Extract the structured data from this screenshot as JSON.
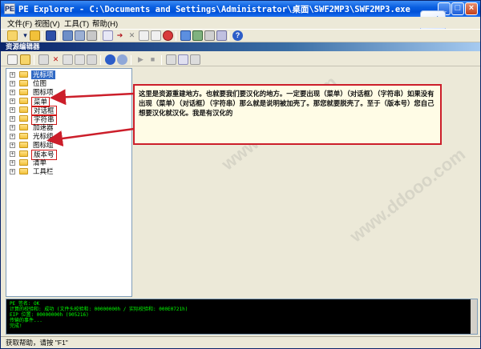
{
  "window": {
    "title": "PE Explorer - C:\\Documents and Settings\\Administrator\\桌面\\SWF2MP3\\SWF2MP3.exe",
    "app_icon": "PE",
    "minimize_label": "_",
    "maximize_label": "□",
    "close_label": "×"
  },
  "menubar": {
    "items": [
      {
        "label": "文件(F)"
      },
      {
        "label": "视图(V)"
      },
      {
        "label": "工具(T)"
      },
      {
        "label": "帮助(H)"
      }
    ]
  },
  "toolbar": {
    "icons": [
      "open-icon",
      "save-icon",
      "headers-icon",
      "sections-icon",
      "resources-icon",
      "imports-icon",
      "exports-icon",
      "disassembler-icon",
      "dependency-icon",
      "help-icon"
    ]
  },
  "panel": {
    "title": "资源编辑器"
  },
  "tree": {
    "items": [
      {
        "label": "光标项",
        "selected": true,
        "highlighted": false
      },
      {
        "label": "位图",
        "selected": false,
        "highlighted": false
      },
      {
        "label": "图标项",
        "selected": false,
        "highlighted": false
      },
      {
        "label": "菜单",
        "selected": false,
        "highlighted": true
      },
      {
        "label": "对话框",
        "selected": false,
        "highlighted": true
      },
      {
        "label": "字符串",
        "selected": false,
        "highlighted": true
      },
      {
        "label": "加速器",
        "selected": false,
        "highlighted": false
      },
      {
        "label": "光标组",
        "selected": false,
        "highlighted": false
      },
      {
        "label": "图标组",
        "selected": false,
        "highlighted": false
      },
      {
        "label": "版本号",
        "selected": false,
        "highlighted": true
      },
      {
        "label": "清单",
        "selected": false,
        "highlighted": false
      },
      {
        "label": "工具栏",
        "selected": false,
        "highlighted": false
      }
    ]
  },
  "callout": {
    "text": "这里是资源重建地方。也就要我们要汉化的地方。一定要出现（菜单）（对话框）（字符串）如果没有出现（菜单）（对话框）（字符串）那么就是说明被加壳了。那您就要脱壳了。至于（版本号）您自己想要汉化就汉化。我是有汉化的"
  },
  "output": {
    "lines": [
      "PE 签名: OK",
      "计算的校验和: 成功 (文件头校验和: 00000000h / 实际校验和: 000E0721h)",
      "EIP 位置: 00000000h  (905216)",
      "传输的事件...",
      "完成!"
    ]
  },
  "statusbar": {
    "text": "获取帮助，请按 \"F1\""
  },
  "colors": {
    "titlebar": "#0a5fe0",
    "callout_border": "#cc1e2a",
    "output_bg": "#000000",
    "output_fg": "#00ff00",
    "selection": "#316ac5"
  }
}
